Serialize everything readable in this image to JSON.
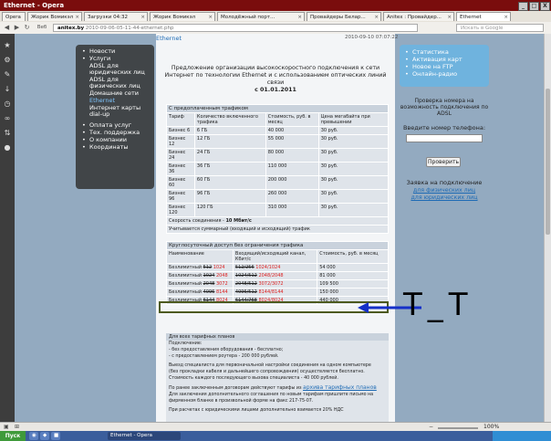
{
  "window": {
    "title": "Ethernet - Opera",
    "buttons": [
      "_",
      "□",
      "X"
    ]
  },
  "tabs": [
    {
      "label": "Opera"
    },
    {
      "label": "Жорик Вомикэл"
    },
    {
      "label": "Загрузки 04:32"
    },
    {
      "label": "Жорик Вомикэл"
    },
    {
      "label": "Молодёжный порт..."
    },
    {
      "label": "Провайдеры Белар..."
    },
    {
      "label": "Anitex : Провайдер..."
    },
    {
      "label": "Ethernet",
      "active": true
    }
  ],
  "addressbar": {
    "web_label": "Веб",
    "domain": "anitex.by",
    "path": "2010-09-06-05-11-44-ethernet.php",
    "search_placeholder": "Искать в Google"
  },
  "sidebar_menu": {
    "items": [
      {
        "label": "Новости"
      },
      {
        "label": "Услуги"
      },
      {
        "label": "ADSL для юридических лиц"
      },
      {
        "label": "ADSL для физических лиц"
      },
      {
        "label": "Домашние сети"
      },
      {
        "label": "Ethernet",
        "current": true
      },
      {
        "label": "Интернет карты dial-up"
      },
      {
        "label": "Оплата услуг"
      },
      {
        "label": "Тех. поддержка"
      },
      {
        "label": "О компании"
      },
      {
        "label": "Координаты"
      }
    ]
  },
  "page": {
    "heading": "Ethernet",
    "date": "2010-09-10 07:07:22",
    "intro": "Предложение организации высокоскоростного подключения к сети Интернет по технологии Ethernet и с использованием оптических линий связи",
    "intro_date": "с 01.01.2011"
  },
  "table1": {
    "caption": "С предоплаченным трафиком",
    "headers": [
      "Тариф",
      "Количество включенного трафика",
      "Стоимость, руб. в месяц",
      "Цена мегабайта при превышении"
    ],
    "rows": [
      [
        "Бизнес 6",
        "6 ГБ",
        "40 000",
        "30 руб."
      ],
      [
        "Бизнес 12",
        "12 ГБ",
        "55 000",
        "30 руб."
      ],
      [
        "Бизнес 24",
        "24 ГБ",
        "80 000",
        "30 руб."
      ],
      [
        "Бизнес 36",
        "36 ГБ",
        "110 000",
        "30 руб."
      ],
      [
        "Бизнес 60",
        "60 ГБ",
        "200 000",
        "30 руб."
      ],
      [
        "Бизнес 96",
        "96 ГБ",
        "260 000",
        "30 руб."
      ],
      [
        "Бизнес 120",
        "120 ГБ",
        "310 000",
        "30 руб."
      ]
    ],
    "speed_label": "Скорость соединения - ",
    "speed_value": "10 Мбит/с",
    "traffic_note": "Учитывается суммарный (входящий и исходящий) трафик"
  },
  "table2": {
    "caption": "Круглосуточный доступ без ограничения трафика",
    "headers": [
      "Наименование",
      "Входящий/исходящий канал, Кбит/с",
      "Стоимость, руб. в месяц"
    ],
    "rows": [
      {
        "name": "Безлимитный",
        "old": "512",
        "new": "1024",
        "ch_old": "512/256",
        "ch_new": "1024/1024",
        "price": "54 000"
      },
      {
        "name": "Безлимитный",
        "old": "1024",
        "new": "2048",
        "ch_old": "1024/512",
        "ch_new": "2048/2048",
        "price": "81 000"
      },
      {
        "name": "Безлимитный",
        "old": "2048",
        "new": "3072",
        "ch_old": "2048/512",
        "ch_new": "3072/3072",
        "price": "109 500"
      },
      {
        "name": "Безлимитный",
        "old": "4096",
        "new": "8144",
        "ch_old": "4096/512",
        "ch_new": "8144/8144",
        "price": "150 000"
      },
      {
        "name": "Безлимитный",
        "old": "6144",
        "new": "8024",
        "ch_old": "6144/768",
        "ch_new": "8024/8024",
        "price": "440 000"
      }
    ]
  },
  "annotation": {
    "text": "T_T",
    "color": "#1530c8"
  },
  "bottom_block": {
    "caption": "Для всех тарифных планов",
    "lines": [
      "Подключение:",
      "- без предоставления оборудования - бесплатно;",
      "- с предоставлением роутера - 200 000 рублей.",
      "Выезд специалиста для первоначальной настройки соединения на одном компьютере",
      "(без прокладки кабеля и дальнейшего сопровождения) осуществляется бесплатно.",
      "Стоимость каждого последующего вызова специалиста - 40 000 рублей."
    ],
    "archive_prefix": "По ранее заключенным договорам действуют тарифы из",
    "archive_link": "архива тарифных планов",
    "more_lines": [
      "Для заключения дополнительного соглашения по новым тарифам пришлите письмо на",
      "фирменном бланке в произвольной форме на факс 217-75-07."
    ],
    "vat_note": "При расчетах с юридическими лицами дополнительно взимается 20% НДС"
  },
  "right_panel": {
    "links": [
      {
        "label": "Статистика"
      },
      {
        "label": "Активация карт"
      },
      {
        "label": "Новое на FTP"
      },
      {
        "label": "Онлайн-радио"
      }
    ],
    "adsl_check_title": "Проверка номера на возможность подключения по ADSL",
    "phone_label": "Введите номер телефона:",
    "phone_value": "",
    "check_button": "Проверить",
    "request_title": "Заявка на подключение",
    "request_individual": "для физических лиц",
    "request_legal": "для юридических лиц"
  },
  "statusbar": {
    "zoom": "100%"
  },
  "taskbar": {
    "start": "Пуск",
    "items": [
      {
        "label": "Ethernet - Opera",
        "active": true
      }
    ]
  },
  "colors": {
    "title_bar": "#7a0d0d",
    "page_bg": "#93aac0",
    "menu_bg": "#414548",
    "link": "#1e6bb5",
    "right_box": "#6fb3de",
    "highlight_border": "#4c5a1e"
  }
}
